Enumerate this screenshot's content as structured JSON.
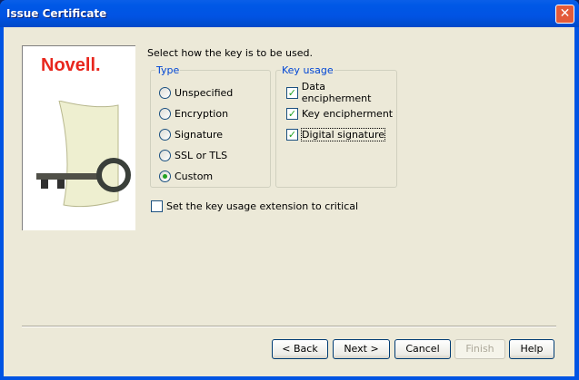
{
  "window": {
    "title": "Issue Certificate"
  },
  "sidebar": {
    "logo": "Novell."
  },
  "instruction": "Select how the key is to be used.",
  "type_group": {
    "legend": "Type",
    "options": [
      {
        "label": "Unspecified",
        "selected": false
      },
      {
        "label": "Encryption",
        "selected": false
      },
      {
        "label": "Signature",
        "selected": false
      },
      {
        "label": "SSL or TLS",
        "selected": false
      },
      {
        "label": "Custom",
        "selected": true
      }
    ]
  },
  "usage_group": {
    "legend": "Key usage",
    "options": [
      {
        "label": "Data encipherment",
        "checked": true
      },
      {
        "label": "Key encipherment",
        "checked": true
      },
      {
        "label": "Digital signature",
        "checked": true
      }
    ]
  },
  "critical": {
    "label": "Set the key usage extension to critical",
    "checked": false
  },
  "buttons": {
    "back": "< Back",
    "next": "Next >",
    "cancel": "Cancel",
    "finish": "Finish",
    "help": "Help"
  }
}
